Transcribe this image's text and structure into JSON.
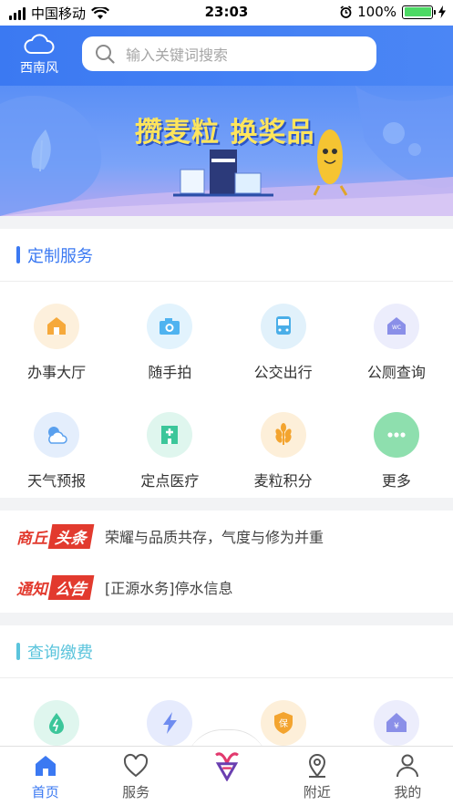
{
  "status": {
    "carrier": "中国移动",
    "time": "23:03",
    "battery": "100%",
    "battery_level": 1.0
  },
  "header": {
    "weather_text": "西南风",
    "search_placeholder": "输入关键词搜索"
  },
  "banner": {
    "title": "攒麦粒 换奖品"
  },
  "custom_service": {
    "title": "定制服务",
    "items": [
      {
        "label": "办事大厅",
        "icon": "hall-icon",
        "color": "#f6a93b",
        "bg": "#fdf0dc"
      },
      {
        "label": "随手拍",
        "icon": "camera-icon",
        "color": "#4fb3f0",
        "bg": "#e2f3fd"
      },
      {
        "label": "公交出行",
        "icon": "bus-icon",
        "color": "#4aaee8",
        "bg": "#e1f1fb"
      },
      {
        "label": "公厕查询",
        "icon": "toilet-icon",
        "color": "#8a8fe8",
        "bg": "#ecedfc"
      },
      {
        "label": "天气预报",
        "icon": "weather-icon",
        "color": "#5aa0ee",
        "bg": "#e4eefc"
      },
      {
        "label": "定点医疗",
        "icon": "hospital-icon",
        "color": "#3cc69a",
        "bg": "#dff6ee"
      },
      {
        "label": "麦粒积分",
        "icon": "wheat-icon",
        "color": "#f3a42f",
        "bg": "#fdefd9"
      },
      {
        "label": "更多",
        "icon": "more-icon",
        "color": "#7dd9a2",
        "bg": "#8edfae"
      }
    ]
  },
  "news": [
    {
      "tag_a": "商丘",
      "tag_b": "头条",
      "text": "荣耀与品质共存，气度与修为并重"
    },
    {
      "tag_a": "通知",
      "tag_b": "公告",
      "text": "[正源水务]停水信息"
    }
  ],
  "query_payment": {
    "title": "查询缴费",
    "items": [
      {
        "icon": "water-icon",
        "color": "#3cc69a",
        "bg": "#dff6ee"
      },
      {
        "icon": "electricity-icon",
        "color": "#6f8cf0",
        "bg": "#e6ebfd"
      },
      {
        "icon": "insurance-icon",
        "color": "#f3a42f",
        "bg": "#fdefd9"
      },
      {
        "icon": "housing-fund-icon",
        "color": "#8a8fe8",
        "bg": "#ecedfc"
      }
    ]
  },
  "tabbar": [
    {
      "label": "首页",
      "icon": "home-icon",
      "active": true
    },
    {
      "label": "服务",
      "icon": "heart-icon",
      "active": false
    },
    {
      "label": "",
      "icon": "city-logo-icon",
      "active": false
    },
    {
      "label": "附近",
      "icon": "location-icon",
      "active": false
    },
    {
      "label": "我的",
      "icon": "user-icon",
      "active": false
    }
  ]
}
